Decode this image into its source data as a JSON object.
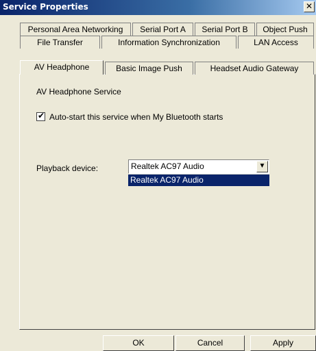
{
  "window": {
    "title": "Service Properties",
    "close_glyph": "✕"
  },
  "tabs": {
    "row1": [
      {
        "label": "Personal Area Networking"
      },
      {
        "label": "Serial Port A"
      },
      {
        "label": "Serial Port B"
      },
      {
        "label": "Object Push"
      }
    ],
    "row2": [
      {
        "label": "File Transfer"
      },
      {
        "label": "Information Synchronization"
      },
      {
        "label": "LAN Access"
      }
    ],
    "row3": [
      {
        "label": "AV Headphone",
        "active": true
      },
      {
        "label": "Basic Image Push"
      },
      {
        "label": "Headset Audio Gateway"
      }
    ]
  },
  "panel": {
    "heading": "AV Headphone Service",
    "autostart": {
      "checked": true,
      "label": "Auto-start this service when My Bluetooth starts"
    },
    "playback": {
      "label": "Playback device:",
      "selected": "Realtek AC97 Audio",
      "options": [
        "Realtek AC97 Audio"
      ]
    }
  },
  "buttons": {
    "ok": "OK",
    "cancel": "Cancel",
    "apply": "Apply"
  },
  "colors": {
    "titlebar": "#0a246a",
    "highlight": "#0a246a",
    "face": "#ece9d8"
  },
  "icons": {
    "checkmark": "✔",
    "dropdown_arrow": "▼"
  }
}
